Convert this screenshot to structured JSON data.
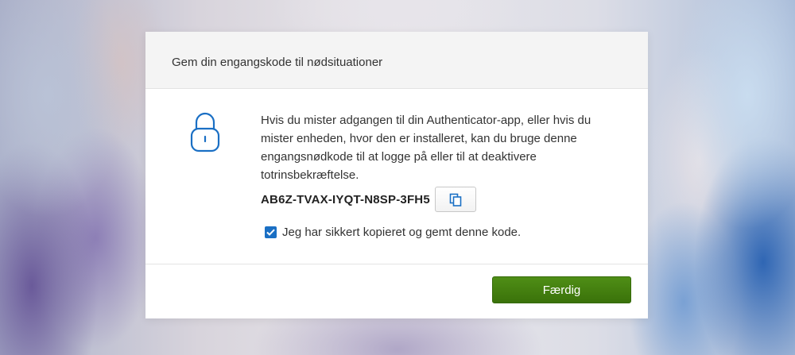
{
  "dialog": {
    "title": "Gem din engangskode til nødsituationer",
    "description": "Hvis du mister adgangen til din Authenticator-app, eller hvis du mister enheden, hvor den er installeret, kan du bruge denne engangsnødkode til at logge på eller til at deaktivere totrinsbekræftelse.",
    "recovery_code": "AB6Z-TVAX-IYQT-N8SP-3FH5",
    "copy_icon": "copy-icon",
    "lock_icon": "lock-icon",
    "checkbox": {
      "label": "Jeg har sikkert kopieret og gemt denne kode.",
      "checked": true
    },
    "done_label": "Færdig"
  },
  "colors": {
    "accent_blue": "#1a6fc4",
    "done_green": "#3f7d0d",
    "header_bg": "#f4f4f4"
  }
}
